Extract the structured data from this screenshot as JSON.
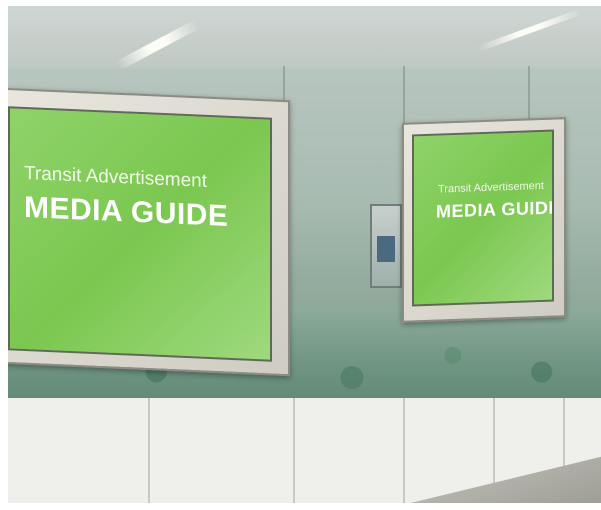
{
  "scene": {
    "subject": "subway corridor with backlit advertising panels",
    "accent_color": "#7bc750",
    "frame_color": "#d8d6cc"
  },
  "ad_left": {
    "line1": "Transit Advertisement",
    "line2": "MEDIA GUIDE"
  },
  "ad_right": {
    "line1": "Transit Advertisement",
    "line2": "MEDIA GUIDE"
  }
}
